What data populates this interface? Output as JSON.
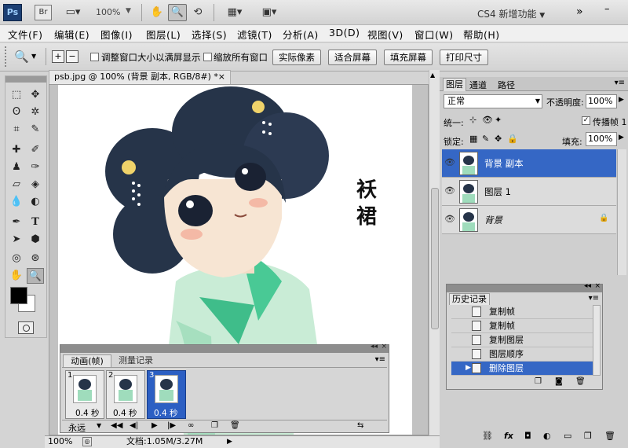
{
  "app": {
    "logo": "Ps",
    "bridge": "Br",
    "zoom_level": "100%",
    "workspace_label": "CS4 新增功能"
  },
  "menu": [
    "文件(F)",
    "编辑(E)",
    "图像(I)",
    "图层(L)",
    "选择(S)",
    "滤镜(T)",
    "分析(A)",
    "3D(D)",
    "视图(V)",
    "窗口(W)",
    "帮助(H)"
  ],
  "options": {
    "resize_window_label": "调整窗口大小以满屏显示",
    "zoom_all_label": "缩放所有窗口",
    "btn_actual": "实际像素",
    "btn_fit": "适合屏幕",
    "btn_fill": "填充屏幕",
    "btn_print": "打印尺寸"
  },
  "document": {
    "tab_title": "psb.jpg @ 100% (背景 副本, RGB/8#) *",
    "artwork_text": [
      "袄",
      "裙"
    ]
  },
  "status": {
    "zoom": "100%",
    "doc_info": "文档:1.05M/3.27M"
  },
  "animation": {
    "tab_animation": "动画(帧)",
    "tab_measure": "测量记录",
    "frames": [
      {
        "num": "1",
        "delay": "0.4 秒"
      },
      {
        "num": "2",
        "delay": "0.4 秒"
      },
      {
        "num": "3",
        "delay": "0.4 秒"
      }
    ],
    "loop": "永远"
  },
  "layers_panel": {
    "tabs": [
      "图层",
      "通道",
      "路径"
    ],
    "blend_mode": "正常",
    "opacity_label": "不透明度:",
    "opacity_value": "100%",
    "unify_label": "统一:",
    "propagate_label": "传播帧 1",
    "lock_label": "锁定:",
    "fill_label": "填充:",
    "fill_value": "100%",
    "layers": [
      {
        "name": "背景 副本",
        "selected": true
      },
      {
        "name": "图层 1",
        "selected": false
      },
      {
        "name": "背景",
        "selected": false,
        "locked": true
      }
    ]
  },
  "history_panel": {
    "title": "历史记录",
    "items": [
      {
        "label": "复制帧",
        "selected": false
      },
      {
        "label": "复制帧",
        "selected": false
      },
      {
        "label": "复制图层",
        "selected": false
      },
      {
        "label": "图层顺序",
        "selected": false
      },
      {
        "label": "删除图层",
        "selected": true
      }
    ]
  },
  "colors": {
    "selection_blue": "#3567c5",
    "foreground": "#000000",
    "background": "#ffffff"
  }
}
